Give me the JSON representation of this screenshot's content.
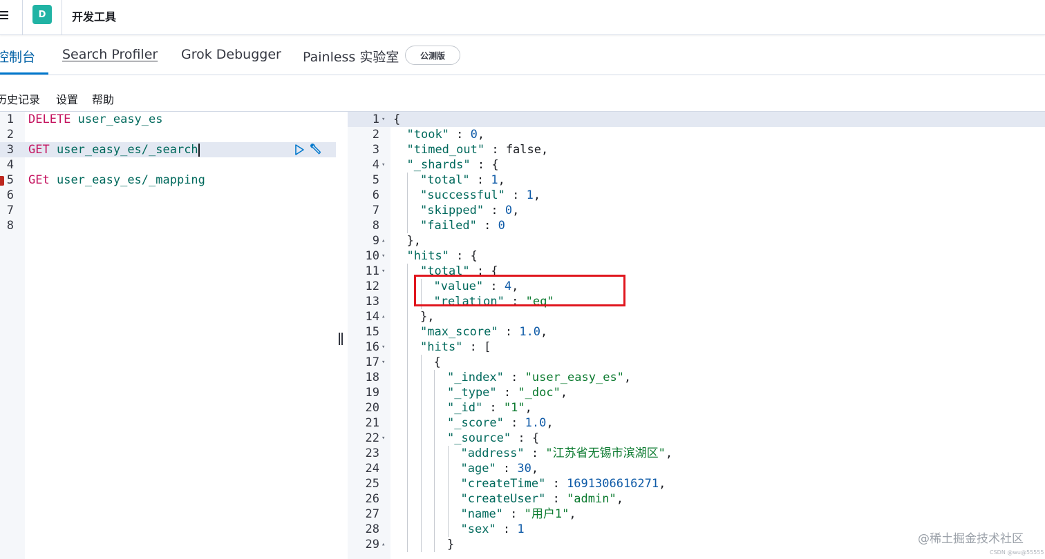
{
  "header": {
    "avatar_letter": "D",
    "app_title": "开发工具"
  },
  "tabs": [
    {
      "label": "控制台",
      "selected": true
    },
    {
      "label": "Search Profiler",
      "selected": false
    },
    {
      "label": "Grok Debugger",
      "selected": false
    },
    {
      "label": "Painless 实验室",
      "selected": false
    }
  ],
  "beta_badge": "公测版",
  "submenu": {
    "history": "历史记录",
    "settings": "设置",
    "help": "帮助"
  },
  "request_editor": {
    "line_numbers": [
      "1",
      "2",
      "3",
      "4",
      "5",
      "6",
      "7",
      "8"
    ],
    "lines": [
      {
        "method": "DELETE",
        "path": "user_easy_es"
      },
      {
        "method": "",
        "path": ""
      },
      {
        "method": "GET",
        "path": "user_easy_es/_search"
      },
      {
        "method": "",
        "path": ""
      },
      {
        "method": "GEt",
        "path": "user_easy_es/_mapping"
      },
      {
        "method": "",
        "path": ""
      },
      {
        "method": "",
        "path": ""
      },
      {
        "method": "",
        "path": ""
      }
    ],
    "active_line": 3,
    "error_line": 5
  },
  "response_editor": {
    "line_numbers": [
      "1",
      "2",
      "3",
      "4",
      "5",
      "6",
      "7",
      "8",
      "9",
      "10",
      "11",
      "12",
      "13",
      "14",
      "15",
      "16",
      "17",
      "18",
      "19",
      "20",
      "21",
      "22",
      "23",
      "24",
      "25",
      "26",
      "27",
      "28",
      "29"
    ],
    "fold_lines": [
      1,
      4,
      9,
      10,
      11,
      14,
      16,
      17,
      22,
      29
    ],
    "lines": [
      "{",
      "\"took\" : 0,",
      "\"timed_out\" : false,",
      "\"_shards\" : {",
      "\"total\" : 1,",
      "\"successful\" : 1,",
      "\"skipped\" : 0,",
      "\"failed\" : 0",
      "},",
      "\"hits\" : {",
      "\"total\" : {",
      "\"value\" : 4,",
      "\"relation\" : \"eq\"",
      "},",
      "\"max_score\" : 1.0,",
      "\"hits\" : [",
      "{",
      "\"_index\" : \"user_easy_es\",",
      "\"_type\" : \"_doc\",",
      "\"_id\" : \"1\",",
      "\"_score\" : 1.0,",
      "\"_source\" : {",
      "\"address\" : \"江苏省无锡市滨湖区\",",
      "\"age\" : 30,",
      "\"createTime\" : 1691306616271,",
      "\"createUser\" : \"admin\",",
      "\"name\" : \"用户1\",",
      "\"sex\" : 1",
      "}"
    ]
  },
  "watermark": "@稀土掘金技术社区",
  "watermark_small": "CSDN @wu@55555"
}
